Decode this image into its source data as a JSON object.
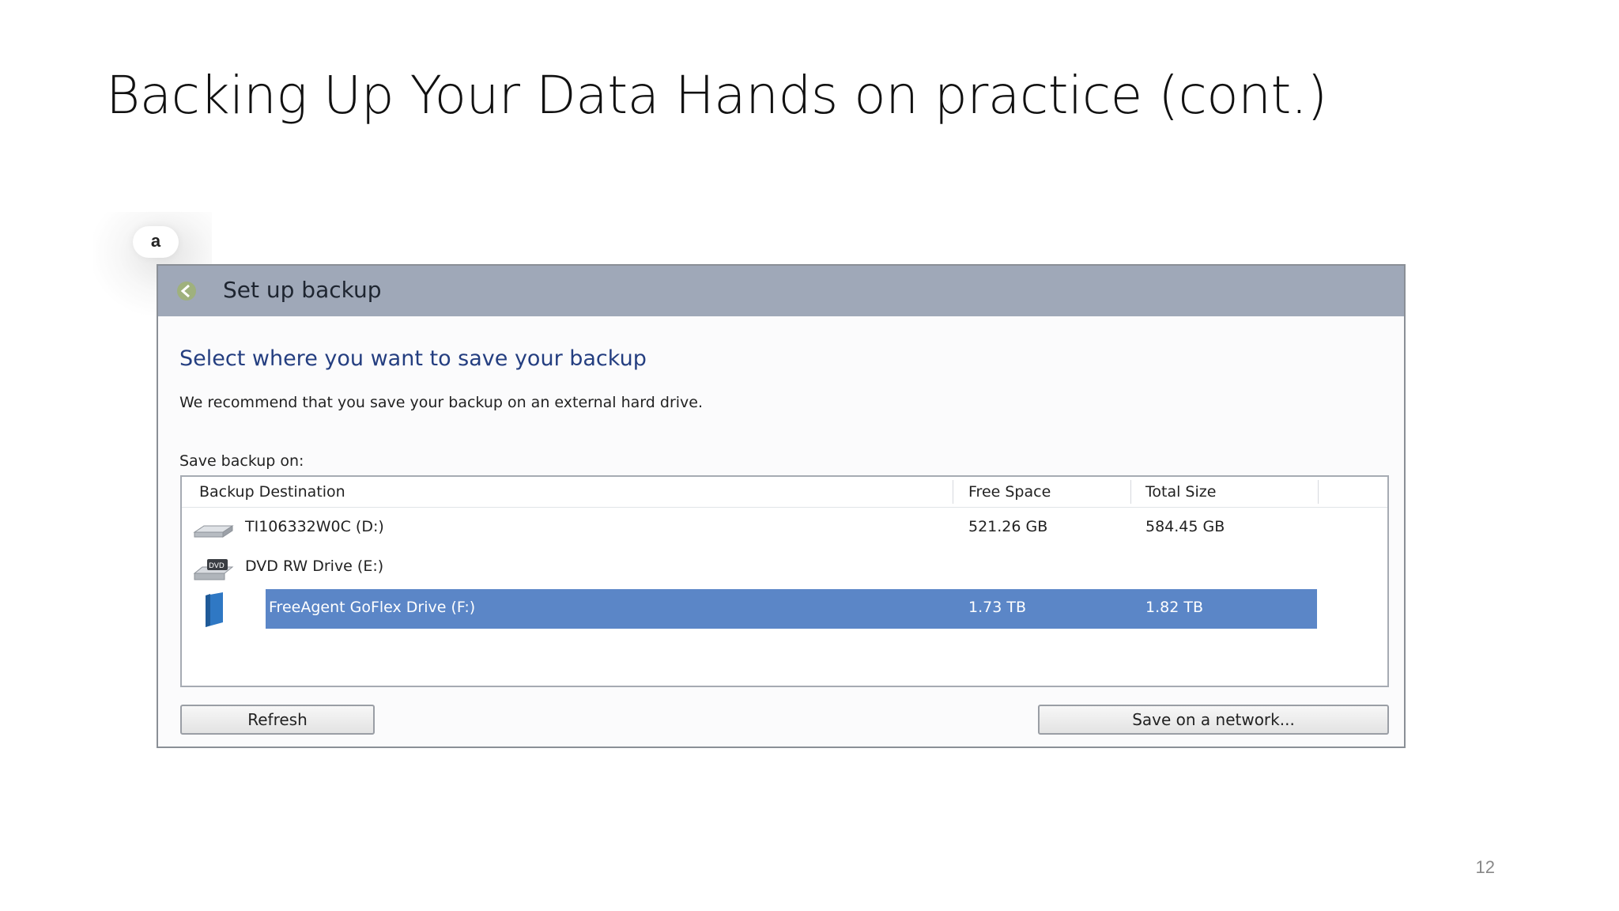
{
  "slide": {
    "title": "Backing Up Your Data Hands on practice (cont.)",
    "page_number": "12",
    "badge": "a"
  },
  "dialog": {
    "title": "Set up backup",
    "heading": "Select where you want to save your backup",
    "recommendation": "We recommend that you save your backup on an external hard drive.",
    "save_on_label": "Save backup on:",
    "columns": {
      "destination": "Backup Destination",
      "free_space": "Free Space",
      "total_size": "Total Size"
    },
    "rows": [
      {
        "name": "TI106332W0C (D:)",
        "free_space": "521.26 GB",
        "total_size": "584.45 GB",
        "icon": "hard-drive-icon",
        "selected": false
      },
      {
        "name": "DVD RW Drive (E:)",
        "free_space": "",
        "total_size": "",
        "icon": "dvd-drive-icon",
        "selected": false
      },
      {
        "name": "FreeAgent GoFlex Drive (F:)",
        "free_space": "1.73 TB",
        "total_size": "1.82 TB",
        "icon": "external-drive-icon",
        "selected": true
      }
    ],
    "buttons": {
      "refresh": "Refresh",
      "network": "Save on a network..."
    }
  },
  "colors": {
    "header_bar": "#9fa8b8",
    "selection": "#5b86c7",
    "heading_text": "#243e80"
  }
}
